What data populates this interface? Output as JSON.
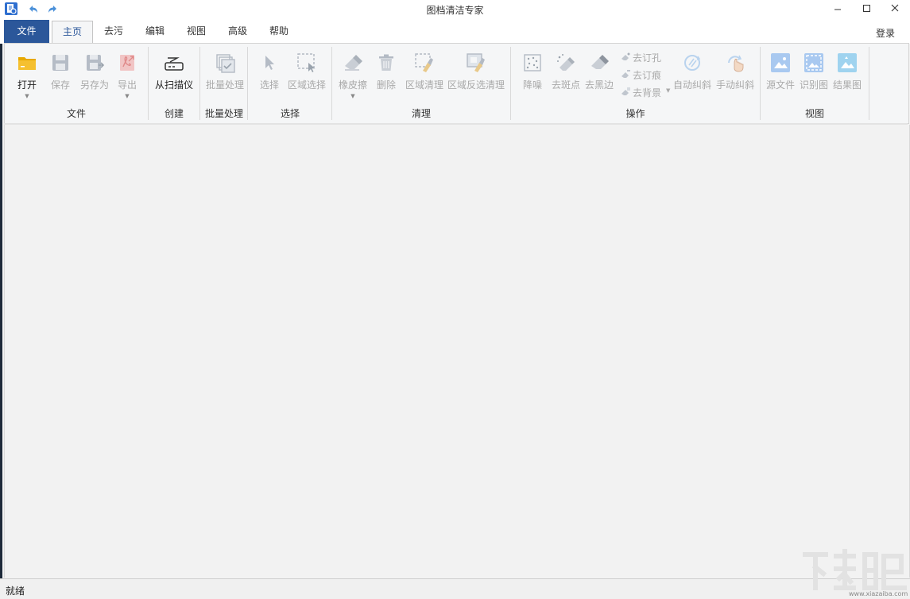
{
  "window": {
    "title": "图档清洁专家"
  },
  "tabs": {
    "file": "文件",
    "home": "主页",
    "stain": "去污",
    "edit": "编辑",
    "view": "视图",
    "advanced": "高级",
    "help": "帮助"
  },
  "login": "登录",
  "ribbon": {
    "groups": {
      "file": "文件",
      "create": "创建",
      "batch": "批量处理",
      "select": "选择",
      "clean": "清理",
      "operate": "操作",
      "view": "视图"
    },
    "buttons": {
      "open": "打开",
      "save": "保存",
      "save_as": "另存为",
      "export": "导出",
      "from_scanner": "从扫描仪",
      "batch_process": "批量处理",
      "select": "选择",
      "region_select": "区域选择",
      "eraser": "橡皮擦",
      "delete": "删除",
      "region_clean": "区域清理",
      "region_inverse_clean": "区域反选清理",
      "denoise": "降噪",
      "despeckle": "去斑点",
      "remove_black_border": "去黑边",
      "remove_punch_holes": "去订孔",
      "remove_staple_marks": "去订痕",
      "remove_background": "去背景",
      "auto_deskew": "自动纠斜",
      "manual_deskew": "手动纠斜",
      "source_image": "源文件",
      "recognized_image": "识别图",
      "result_image": "结果图"
    }
  },
  "status": {
    "text": "就绪"
  },
  "watermark": {
    "text": "下载吧",
    "site": "www.xiazaiba.com"
  },
  "colors": {
    "file_tab": "#2b579a",
    "disabled_text": "#a9a9a9",
    "folder_icon": "#f0b400",
    "view_icon": "#9fc4ee"
  }
}
